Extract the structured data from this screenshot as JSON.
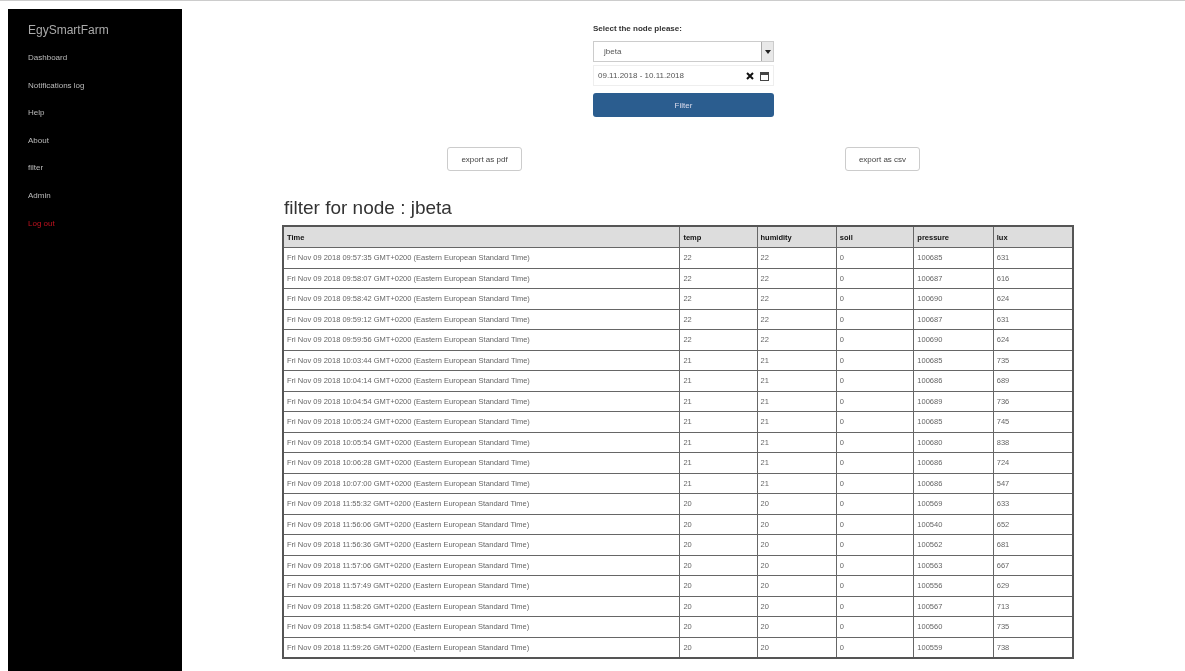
{
  "sidebar": {
    "brand": "EgySmartFarm",
    "items": [
      {
        "label": "Dashboard",
        "kind": "link"
      },
      {
        "label": "Notifications log",
        "kind": "link"
      },
      {
        "label": "Help",
        "kind": "link"
      },
      {
        "label": "About",
        "kind": "link"
      },
      {
        "label": "filter",
        "kind": "link"
      },
      {
        "label": "Admin",
        "kind": "link"
      },
      {
        "label": "Log out",
        "kind": "logout"
      }
    ]
  },
  "form": {
    "label": "Select the node please:",
    "node_select": {
      "value": "jbeta"
    },
    "date_range": {
      "value": "09.11.2018 - 10.11.2018"
    },
    "filter_button": "Filter"
  },
  "export_buttons": [
    "export as pdf",
    "export as csv"
  ],
  "heading": "filter for node : jbeta",
  "table": {
    "columns": [
      "Time",
      "temp",
      "humidity",
      "soil",
      "pressure",
      "lux"
    ],
    "rows": [
      [
        "Fri Nov 09 2018 09:57:35 GMT+0200 (Eastern European Standard Time)",
        "22",
        "22",
        "0",
        "100685",
        "631"
      ],
      [
        "Fri Nov 09 2018 09:58:07 GMT+0200 (Eastern European Standard Time)",
        "22",
        "22",
        "0",
        "100687",
        "616"
      ],
      [
        "Fri Nov 09 2018 09:58:42 GMT+0200 (Eastern European Standard Time)",
        "22",
        "22",
        "0",
        "100690",
        "624"
      ],
      [
        "Fri Nov 09 2018 09:59:12 GMT+0200 (Eastern European Standard Time)",
        "22",
        "22",
        "0",
        "100687",
        "631"
      ],
      [
        "Fri Nov 09 2018 09:59:56 GMT+0200 (Eastern European Standard Time)",
        "22",
        "22",
        "0",
        "100690",
        "624"
      ],
      [
        "Fri Nov 09 2018 10:03:44 GMT+0200 (Eastern European Standard Time)",
        "21",
        "21",
        "0",
        "100685",
        "735"
      ],
      [
        "Fri Nov 09 2018 10:04:14 GMT+0200 (Eastern European Standard Time)",
        "21",
        "21",
        "0",
        "100686",
        "689"
      ],
      [
        "Fri Nov 09 2018 10:04:54 GMT+0200 (Eastern European Standard Time)",
        "21",
        "21",
        "0",
        "100689",
        "736"
      ],
      [
        "Fri Nov 09 2018 10:05:24 GMT+0200 (Eastern European Standard Time)",
        "21",
        "21",
        "0",
        "100685",
        "745"
      ],
      [
        "Fri Nov 09 2018 10:05:54 GMT+0200 (Eastern European Standard Time)",
        "21",
        "21",
        "0",
        "100680",
        "838"
      ],
      [
        "Fri Nov 09 2018 10:06:28 GMT+0200 (Eastern European Standard Time)",
        "21",
        "21",
        "0",
        "100686",
        "724"
      ],
      [
        "Fri Nov 09 2018 10:07:00 GMT+0200 (Eastern European Standard Time)",
        "21",
        "21",
        "0",
        "100686",
        "547"
      ],
      [
        "Fri Nov 09 2018 11:55:32 GMT+0200 (Eastern European Standard Time)",
        "20",
        "20",
        "0",
        "100569",
        "633"
      ],
      [
        "Fri Nov 09 2018 11:56:06 GMT+0200 (Eastern European Standard Time)",
        "20",
        "20",
        "0",
        "100540",
        "652"
      ],
      [
        "Fri Nov 09 2018 11:56:36 GMT+0200 (Eastern European Standard Time)",
        "20",
        "20",
        "0",
        "100562",
        "681"
      ],
      [
        "Fri Nov 09 2018 11:57:06 GMT+0200 (Eastern European Standard Time)",
        "20",
        "20",
        "0",
        "100563",
        "667"
      ],
      [
        "Fri Nov 09 2018 11:57:49 GMT+0200 (Eastern European Standard Time)",
        "20",
        "20",
        "0",
        "100556",
        "629"
      ],
      [
        "Fri Nov 09 2018 11:58:26 GMT+0200 (Eastern European Standard Time)",
        "20",
        "20",
        "0",
        "100567",
        "713"
      ],
      [
        "Fri Nov 09 2018 11:58:54 GMT+0200 (Eastern European Standard Time)",
        "20",
        "20",
        "0",
        "100560",
        "735"
      ],
      [
        "Fri Nov 09 2018 11:59:26 GMT+0200 (Eastern European Standard Time)",
        "20",
        "20",
        "0",
        "100559",
        "738"
      ]
    ]
  }
}
